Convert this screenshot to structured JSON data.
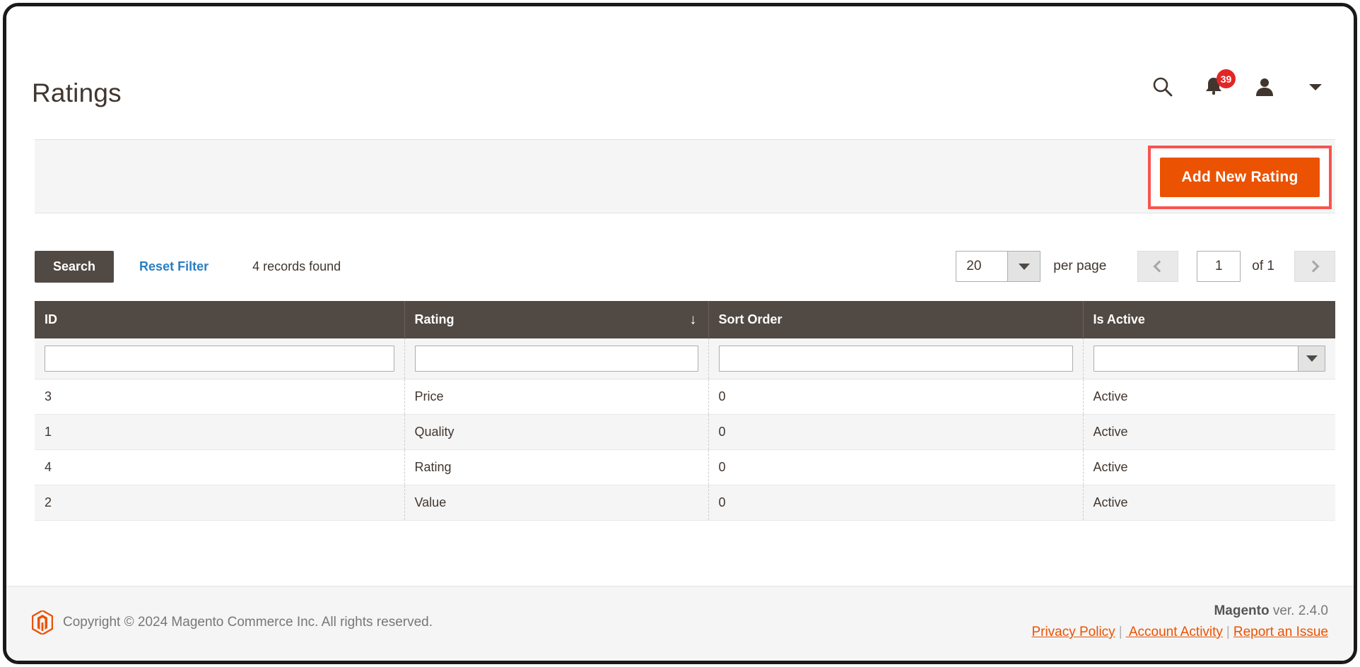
{
  "header": {
    "page_title": "Ratings",
    "icons": {
      "search": "search-icon",
      "notifications": "bell-icon",
      "notification_count": "39",
      "account": "user-icon",
      "dropdown": "caret-down-icon"
    }
  },
  "page_actions": {
    "add_new_label": "Add New Rating",
    "highlight_color": "#f9534f",
    "button_color": "#eb5202"
  },
  "toolbar": {
    "search_label": "Search",
    "reset_label": "Reset Filter",
    "records_found": "4 records found",
    "per_page_value": "20",
    "per_page_label": "per page",
    "page_value": "1",
    "of_total": "of 1",
    "prev_icon": "chevron-left-icon",
    "next_icon": "chevron-right-icon"
  },
  "grid": {
    "columns": [
      {
        "label": "ID",
        "sorted": false
      },
      {
        "label": "Rating",
        "sorted": true,
        "sort_arrow": "↓"
      },
      {
        "label": "Sort Order",
        "sorted": false
      },
      {
        "label": "Is Active",
        "sorted": false
      }
    ],
    "filters": {
      "id": "",
      "rating": "",
      "sort_order": "",
      "is_active": ""
    },
    "rows": [
      {
        "id": "3",
        "rating": "Price",
        "sort_order": "0",
        "is_active": "Active"
      },
      {
        "id": "1",
        "rating": "Quality",
        "sort_order": "0",
        "is_active": "Active"
      },
      {
        "id": "4",
        "rating": "Rating",
        "sort_order": "0",
        "is_active": "Active"
      },
      {
        "id": "2",
        "rating": "Value",
        "sort_order": "0",
        "is_active": "Active"
      }
    ]
  },
  "footer": {
    "copyright": "Copyright © 2024 Magento Commerce Inc. All rights reserved.",
    "brand": "Magento",
    "version": " ver. 2.4.0",
    "links": [
      {
        "label": "Privacy Policy"
      },
      {
        "label": " Account Activity"
      },
      {
        "label": "Report an Issue"
      }
    ],
    "separator": "|"
  }
}
